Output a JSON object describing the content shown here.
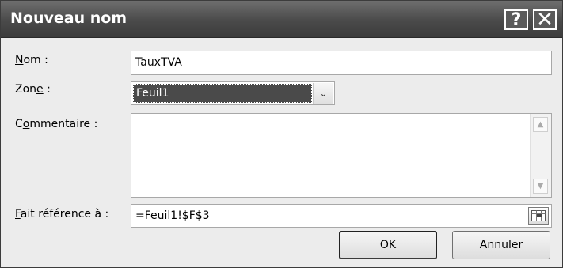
{
  "window": {
    "title": "Nouveau nom",
    "help_glyph": "?",
    "close_glyph": "✕"
  },
  "form": {
    "name_label": {
      "accel": "N",
      "rest": "om :"
    },
    "name_value": "TauxTVA",
    "zone_label": {
      "pre": "Zon",
      "accel": "e",
      "rest": " :"
    },
    "zone_value": "Feuil1",
    "comment_label": {
      "pre": "C",
      "accel": "o",
      "rest": "mmentaire :"
    },
    "comment_value": "",
    "refers_label": {
      "accel": "F",
      "rest": "ait référence à :"
    },
    "refers_value": "=Feuil1!$F$3"
  },
  "buttons": {
    "ok": "OK",
    "cancel": "Annuler"
  },
  "icons": {
    "dropdown": "chevron-down-icon",
    "scroll_up": "scroll-up-icon",
    "scroll_down": "scroll-down-icon",
    "range_select": "range-select-icon"
  }
}
